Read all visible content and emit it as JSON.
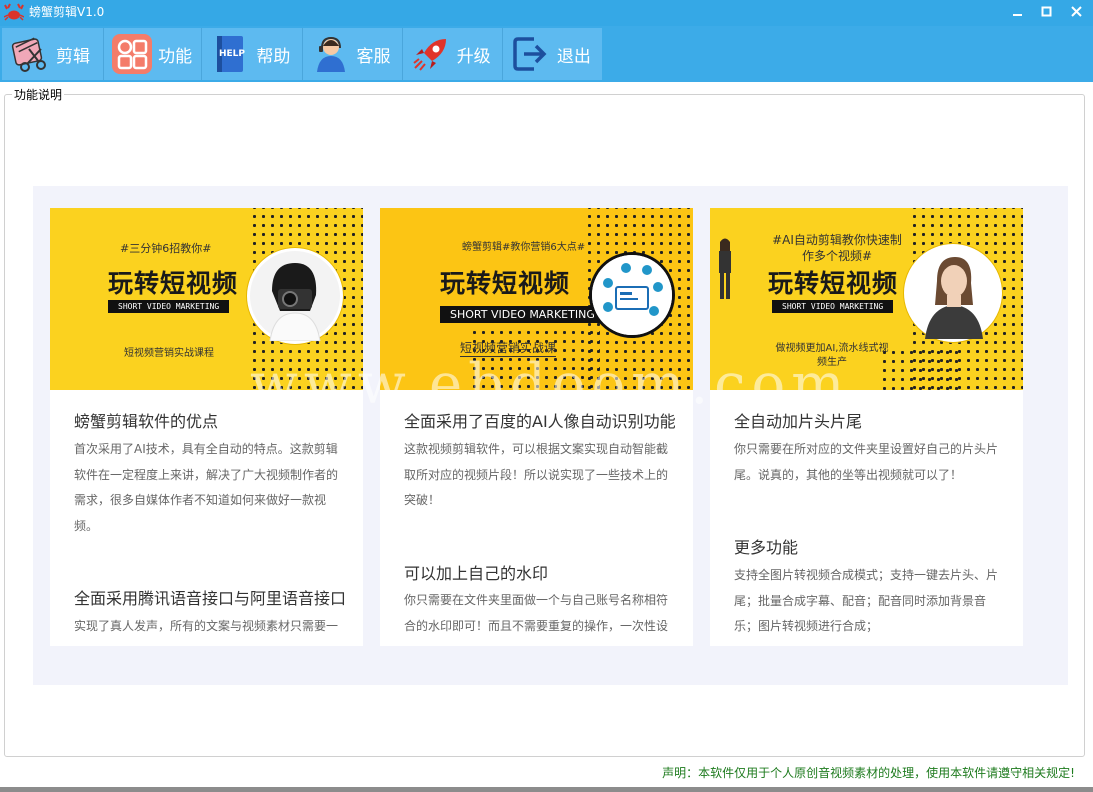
{
  "window": {
    "title": "螃蟹剪辑V1.0",
    "controls": {
      "minimize": "minimize-icon",
      "maximize": "maximize-icon",
      "close": "close-icon"
    }
  },
  "toolbar": {
    "items": [
      {
        "label": "剪辑",
        "icon": "clapperboard-scissors-icon"
      },
      {
        "label": "功能",
        "icon": "grid-apps-icon"
      },
      {
        "label": "帮助",
        "icon": "help-book-icon"
      },
      {
        "label": "客服",
        "icon": "customer-service-icon"
      },
      {
        "label": "升级",
        "icon": "rocket-icon"
      },
      {
        "label": "退出",
        "icon": "exit-arrow-icon"
      }
    ]
  },
  "groupbox": {
    "title": "功能说明"
  },
  "cards": [
    {
      "banner": {
        "tag": "#三分钟6招教你#",
        "main": "玩转短视频",
        "en": "SHORT VIDEO MARKETING",
        "footer": "短视频营销实战课程"
      },
      "sections": [
        {
          "heading": "螃蟹剪辑软件的优点",
          "text": "首次采用了AI技术，具有全自动的特点。这款剪辑软件在一定程度上来讲，解决了广大视频制作者的需求，很多自媒体作者不知道如何来做好一款视频。"
        },
        {
          "heading": "全面采用腾讯语音接口与阿里语音接口",
          "text": "实现了真人发声，所有的文案与视频素材只需要一"
        }
      ]
    },
    {
      "banner": {
        "tag": "螃蟹剪辑#教你营销6大点#",
        "main": "玩转短视频",
        "en": "SHORT VIDEO MARKETING",
        "footer": "短视频营销实战课"
      },
      "sections": [
        {
          "heading": "全面采用了百度的AI人像自动识别功能",
          "text": "这款视频剪辑软件，可以根据文案实现自动智能截取所对应的视频片段！所以说实现了一些技术上的突破！"
        },
        {
          "heading": "可以加上自己的水印",
          "text": "你只需要在文件夹里面做一个与自己账号名称相符合的水印即可！而且不需要重复的操作，一次性设"
        }
      ]
    },
    {
      "banner": {
        "tag": "#AI自动剪辑教你快速制作多个视频#",
        "main": "玩转短视频",
        "en": "SHORT VIDEO MARKETING",
        "footer": "做视频更加AI,流水线式视频生产"
      },
      "sections": [
        {
          "heading": "全自动加片头片尾",
          "text": "你只需要在所对应的文件夹里设置好自己的片头片尾。说真的，其他的坐等出视频就可以了！"
        },
        {
          "heading": "更多功能",
          "text": "支持全图片转视频合成模式；支持一键去片头、片尾；批量合成字幕、配音；配音同时添加背景音乐；图片转视频进行合成；"
        }
      ]
    }
  ],
  "watermark": "www.ebdoom.com",
  "statement": "声明：本软件仅用于个人原创音视频素材的处理，使用本软件请遵守相关规定!",
  "colors": {
    "titlebar": "#35a8e6",
    "toolbar": "#3cabe8",
    "banner": "#fbd21f",
    "statement": "#1e7b1e"
  }
}
